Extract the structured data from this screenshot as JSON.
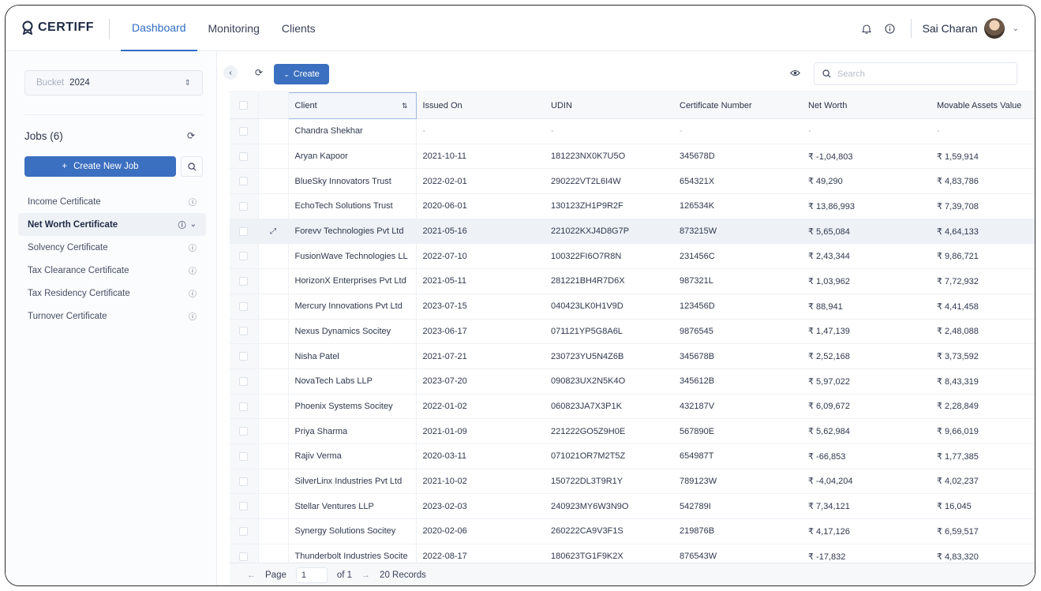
{
  "app": {
    "logo_text": "CERTIFF"
  },
  "nav": {
    "tabs": [
      {
        "label": "Dashboard",
        "active": true
      },
      {
        "label": "Monitoring"
      },
      {
        "label": "Clients"
      }
    ]
  },
  "header": {
    "user_name": "Sai Charan"
  },
  "sidebar": {
    "bucket_label": "Bucket",
    "bucket_value": "2024",
    "jobs_title": "Jobs (6)",
    "create_job_label": "Create New Job",
    "jobs": [
      {
        "label": "Income Certificate"
      },
      {
        "label": "Net Worth Certificate",
        "active": true
      },
      {
        "label": "Solvency Certificate"
      },
      {
        "label": "Tax Clearance Certificate"
      },
      {
        "label": "Tax Residency Certificate"
      },
      {
        "label": "Turnover Certificate"
      }
    ]
  },
  "toolbar": {
    "create_label": "Create",
    "search_placeholder": "Search"
  },
  "table": {
    "columns": [
      "Client",
      "Issued On",
      "UDIN",
      "Certificate Number",
      "Net Worth",
      "Movable Assets Value"
    ],
    "rows": [
      [
        "Chandra Shekhar",
        "-",
        "-",
        "-",
        "-",
        "-"
      ],
      [
        "Aryan Kapoor",
        "2021-10-11",
        "181223NX0K7U5O",
        "345678D",
        "₹ -1,04,803",
        "₹ 1,59,914"
      ],
      [
        "BlueSky Innovators Trust",
        "2022-02-01",
        "290222VT2L6I4W",
        "654321X",
        "₹ 49,290",
        "₹ 4,83,786"
      ],
      [
        "EchoTech Solutions Trust",
        "2020-06-01",
        "130123ZH1P9R2F",
        "126534K",
        "₹ 13,86,993",
        "₹ 7,39,708"
      ],
      [
        "Forevv Technologies Pvt Ltd",
        "2021-05-16",
        "221022KXJ4D8G7P",
        "873215W",
        "₹ 5,65,084",
        "₹ 4,64,133"
      ],
      [
        "FusionWave Technologies LL",
        "2022-07-10",
        "100322FI6O7R8N",
        "231456C",
        "₹ 2,43,344",
        "₹ 9,86,721"
      ],
      [
        "HorizonX Enterprises Pvt Ltd",
        "2021-05-11",
        "281221BH4R7D6X",
        "987321L",
        "₹ 1,03,962",
        "₹ 7,72,932"
      ],
      [
        "Mercury Innovations Pvt Ltd",
        "2023-07-15",
        "040423LK0H1V9D",
        "123456D",
        "₹ 88,941",
        "₹ 4,41,458"
      ],
      [
        "Nexus Dynamics Socitey",
        "2023-06-17",
        "071121YP5G8A6L",
        "9876545",
        "₹ 1,47,139",
        "₹ 2,48,088"
      ],
      [
        "Nisha Patel",
        "2021-07-21",
        "230723YU5N4Z6B",
        "345678B",
        "₹ 2,52,168",
        "₹ 3,73,592"
      ],
      [
        "NovaTech Labs LLP",
        "2023-07-20",
        "090823UX2N5K4O",
        "345612B",
        "₹ 5,97,022",
        "₹ 8,43,319"
      ],
      [
        "Phoenix Systems Socitey",
        "2022-01-02",
        "060823JA7X3P1K",
        "432187V",
        "₹ 6,09,672",
        "₹ 2,28,849"
      ],
      [
        "Priya Sharma",
        "2021-01-09",
        "221222GO5Z9H0E",
        "567890E",
        "₹ 5,62,984",
        "₹ 9,66,019"
      ],
      [
        "Rajiv Verma",
        "2020-03-11",
        "071021OR7M2T5Z",
        "654987T",
        "₹ -66,853",
        "₹ 1,77,385"
      ],
      [
        "SilverLinx Industries Pvt Ltd",
        "2021-10-02",
        "150722DL3T9R1Y",
        "789123W",
        "₹ -4,04,204",
        "₹ 4,02,237"
      ],
      [
        "Stellar Ventures LLP",
        "2023-02-03",
        "240923MY6W3N9O",
        "542789I",
        "₹ 7,34,121",
        "₹ 16,045"
      ],
      [
        "Synergy Solutions Socitey",
        "2020-02-06",
        "260222CA9V3F1S",
        "219876B",
        "₹ 4,17,126",
        "₹ 6,59,517"
      ],
      [
        "Thunderbolt Industries Socite",
        "2022-08-17",
        "180623TG1F9K2X",
        "876543W",
        "₹ -17,832",
        "₹ 4,83,320"
      ]
    ],
    "highlighted_row": 4
  },
  "footer": {
    "page_label": "Page",
    "page_value": "1",
    "of_label": "of 1",
    "records": "20 Records"
  }
}
